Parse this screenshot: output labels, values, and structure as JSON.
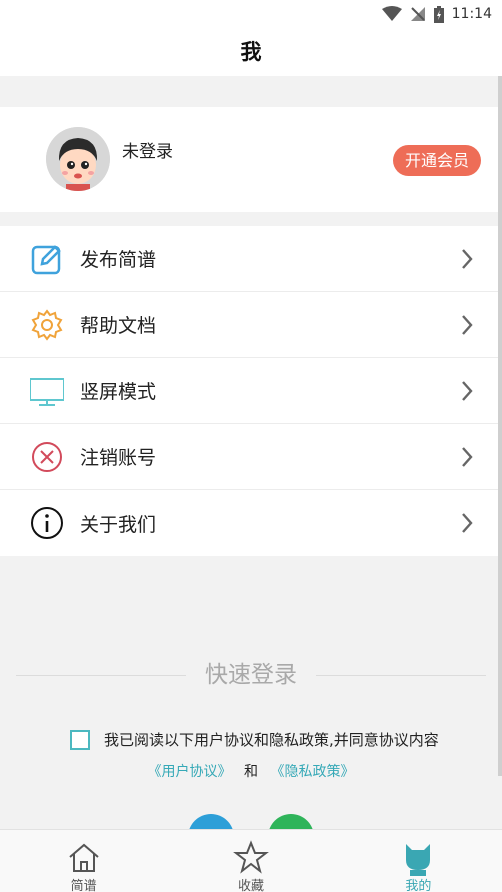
{
  "status_bar": {
    "time": "11:14"
  },
  "header": {
    "title": "我"
  },
  "profile": {
    "login_status": "未登录",
    "vip_button_label": "开通会员"
  },
  "menu": {
    "items": [
      {
        "label": "发布简谱",
        "icon": "edit-icon"
      },
      {
        "label": "帮助文档",
        "icon": "gear-icon"
      },
      {
        "label": "竖屏模式",
        "icon": "monitor-icon"
      },
      {
        "label": "注销账号",
        "icon": "cancel-icon"
      },
      {
        "label": "关于我们",
        "icon": "info-icon"
      }
    ]
  },
  "quick_login": {
    "title": "快速登录",
    "agreement_text": "我已阅读以下用户协议和隐私政策,并同意协议内容",
    "user_agreement_link": "《用户协议》",
    "and_text": "和",
    "privacy_policy_link": "《隐私政策》"
  },
  "tabbar": {
    "tabs": [
      {
        "label": "简谱",
        "icon": "home-icon"
      },
      {
        "label": "收藏",
        "icon": "star-icon"
      },
      {
        "label": "我的",
        "icon": "cat-icon",
        "active": true
      }
    ]
  },
  "colors": {
    "accent": "#3aa7b3",
    "vip": "#ee6d57"
  }
}
